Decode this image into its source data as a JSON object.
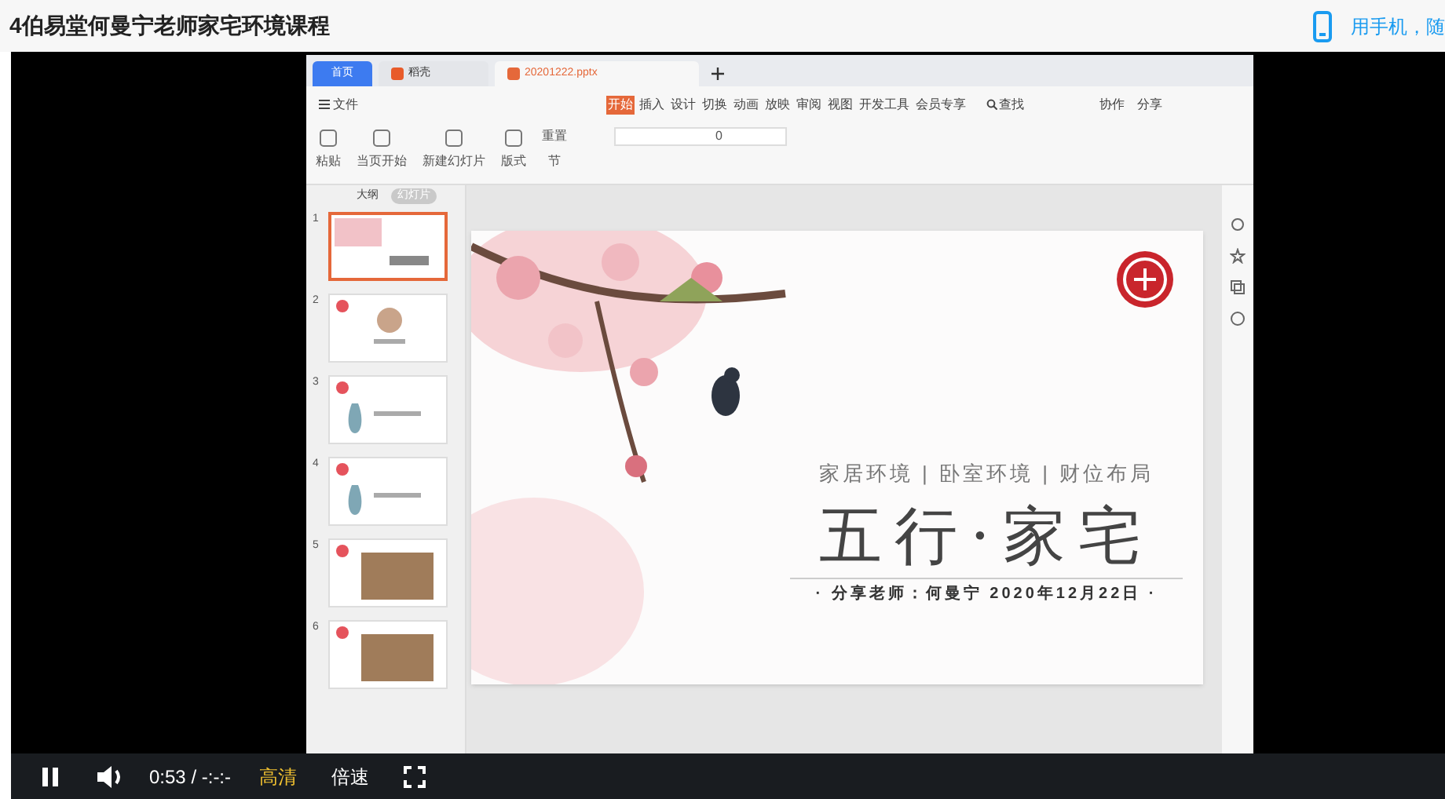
{
  "page_title": "4伯易堂何曼宁老师家宅环境课程",
  "mobile_link": "用手机，随",
  "app": {
    "tabs": [
      {
        "label": "首页",
        "kind": "home",
        "selected": false
      },
      {
        "label": "稻壳",
        "kind": "docer",
        "selected": false
      },
      {
        "label": "20201222.pptx",
        "kind": "doc",
        "selected": true
      }
    ],
    "file_menu": "文件",
    "menu": [
      {
        "label": "开始",
        "selected": true
      },
      {
        "label": "插入",
        "selected": false
      },
      {
        "label": "设计",
        "selected": false
      },
      {
        "label": "切换",
        "selected": false
      },
      {
        "label": "动画",
        "selected": false
      },
      {
        "label": "放映",
        "selected": false
      },
      {
        "label": "审阅",
        "selected": false
      },
      {
        "label": "视图",
        "selected": false
      },
      {
        "label": "开发工具",
        "selected": false
      },
      {
        "label": "会员专享",
        "selected": false
      }
    ],
    "search": "查找",
    "actions": [
      "协作",
      "分享"
    ],
    "ribbon": [
      "粘贴",
      "当页开始",
      "新建幻灯片",
      "版式"
    ],
    "ribbon_small": [
      "重置",
      "节"
    ],
    "font_size": "0",
    "panel_tabs": [
      {
        "label": "大纲",
        "selected": false
      },
      {
        "label": "幻灯片",
        "selected": true
      }
    ],
    "slides": [
      {
        "number": "1",
        "kind": "title",
        "selected": true
      },
      {
        "number": "2",
        "kind": "logo",
        "selected": false
      },
      {
        "number": "3",
        "kind": "vase",
        "selected": false
      },
      {
        "number": "4",
        "kind": "vase",
        "selected": false
      },
      {
        "number": "5",
        "selected": false
      },
      {
        "number": "6",
        "selected": false
      }
    ],
    "slide": {
      "subtitle": "家居环境 | 卧室环境 | 财位布局",
      "title": "五行·家宅",
      "byline": "· 分享老师：何曼宁  2020年12月22日 ·"
    }
  },
  "player": {
    "playing": true,
    "time": "0:53",
    "separator": "/",
    "duration": "-:-:-",
    "quality": "高清",
    "speed": "倍速"
  }
}
